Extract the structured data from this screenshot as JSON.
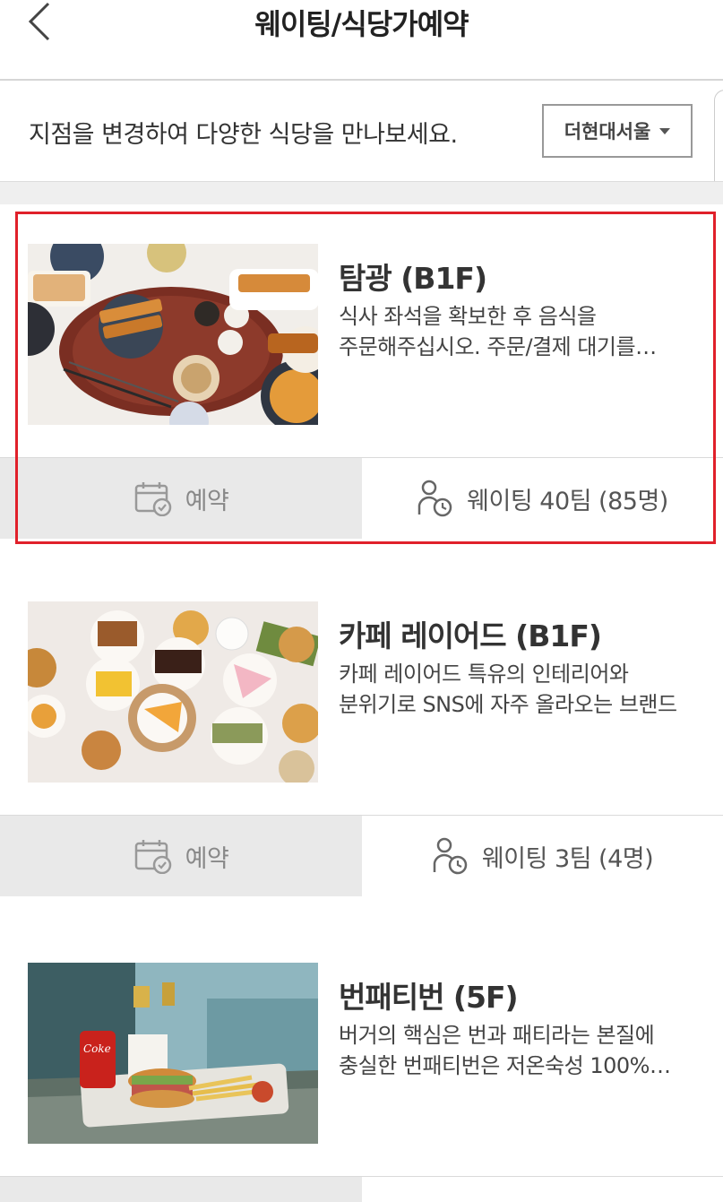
{
  "header": {
    "title": "웨이팅/식당가예약"
  },
  "branch": {
    "prompt": "지점을 변경하여 다양한 식당을 만나보세요.",
    "selected": "더현대서울"
  },
  "restaurants": [
    {
      "name": "탐광 (B1F)",
      "desc_line1": "식사 좌석을 확보한 후 음식을",
      "desc_line2": "주문해주십시오. 주문/결제 대기를…",
      "reserve_label": "예약",
      "waiting_label": "웨이팅 40팀 (85명)"
    },
    {
      "name": "카페 레이어드 (B1F)",
      "desc_line1": "카페 레이어드 특유의 인테리어와",
      "desc_line2": "분위기로 SNS에 자주 올라오는 브랜드",
      "reserve_label": "예약",
      "waiting_label": "웨이팅 3팀 (4명)"
    },
    {
      "name": "번패티번 (5F)",
      "desc_line1": "버거의 핵심은 번과 패티라는 본질에",
      "desc_line2": "충실한 번패티번은 저온숙성 100%…",
      "reserve_label": "",
      "waiting_label": ""
    }
  ],
  "icons": {
    "back": "chevron-left-icon",
    "dropdown": "caret-down-icon",
    "reserve": "calendar-check-icon",
    "waiting": "person-clock-icon"
  },
  "colors": {
    "highlight": "#e0202a",
    "reserve_bg": "#e9e9e9",
    "gap_bg": "#efefef"
  }
}
